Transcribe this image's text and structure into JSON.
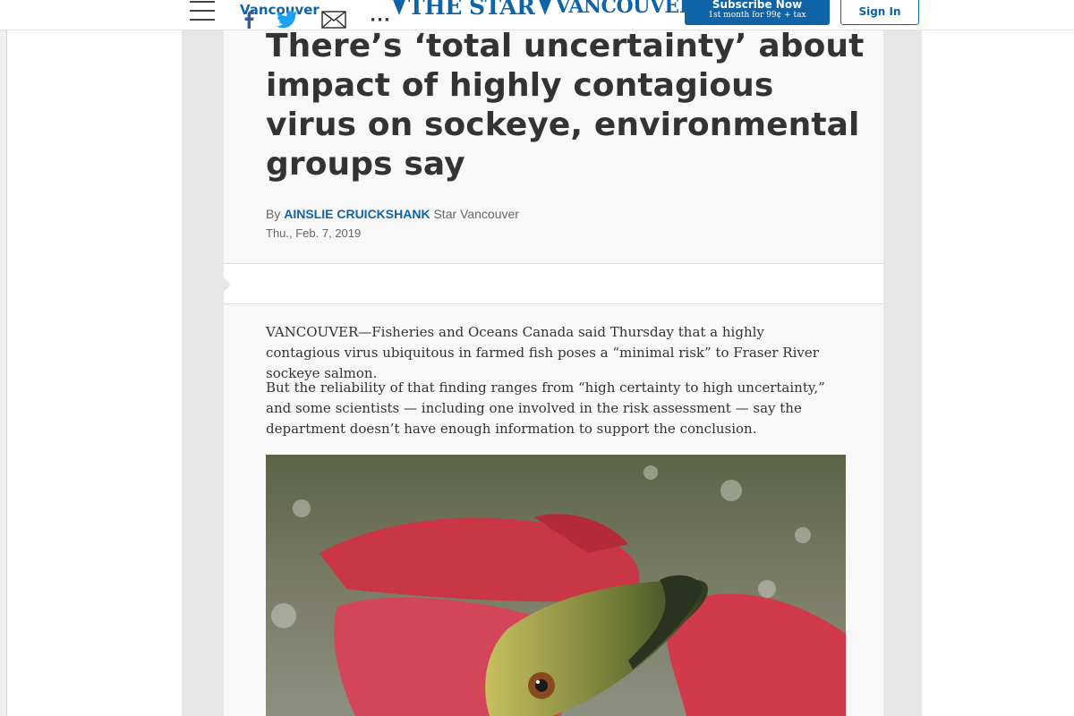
{
  "nav": {
    "section": "Vancouver",
    "logo": {
      "part1": "THE STAR",
      "part2": "VANCOUVER"
    },
    "subscribe": {
      "title": "Subscribe Now",
      "subtitle": "1st month for 99¢ + tax"
    },
    "sign_in": "Sign In"
  },
  "article": {
    "headline": "There’s ‘total uncertainty’ about impact of highly contagious virus on sockeye, environmental groups say",
    "byline_prefix": "By",
    "author": "AINSLIE CRUICKSHANK",
    "outlet": "Star Vancouver",
    "date": "Thu., Feb. 7, 2019",
    "paragraphs": [
      "VANCOUVER—Fisheries and Oceans Canada said Thursday that a highly contagious virus ubiquitous in farmed fish poses a “minimal risk” to Fraser River sockeye salmon.",
      "But the reliability of that finding ranges from “high certainty to high uncertainty,” and some scientists — including one involved in the risk assessment — say the department doesn’t have enough information to support the conclusion."
    ]
  },
  "share": {
    "icons": [
      "facebook-icon",
      "twitter-icon",
      "email-icon",
      "more-icon"
    ],
    "more_label": "···"
  },
  "colors": {
    "brand_blue": "#0f64a8",
    "twitter_blue": "#1da1f2",
    "facebook_blue": "#3b5998"
  }
}
